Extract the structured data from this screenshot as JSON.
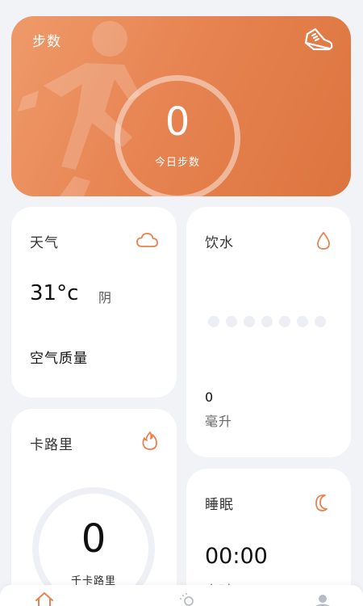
{
  "colors": {
    "accent": "#e8834f",
    "background": "#f2f3f7",
    "card": "#ffffff"
  },
  "steps": {
    "title": "步数",
    "value": "0",
    "subtitle": "今日步数",
    "icon": "shoe-icon"
  },
  "weather": {
    "title": "天气",
    "temperature": "31°c",
    "condition": "阴",
    "air_quality_label": "空气质量",
    "icon": "cloud-icon"
  },
  "water": {
    "title": "饮水",
    "value": "0",
    "unit": "毫升",
    "icon": "water-drop-icon",
    "cups_total": 7,
    "cups_filled": 0
  },
  "calorie": {
    "title": "卡路里",
    "value": "0",
    "unit": "千卡路里",
    "icon": "flame-icon"
  },
  "sleep": {
    "title": "睡眠",
    "value": "00:00",
    "unit": "小时",
    "icon": "moon-icon"
  },
  "tabbar": {
    "items": [
      "home-icon",
      "sleep-stats-icon",
      "profile-icon"
    ],
    "active_index": 0
  }
}
